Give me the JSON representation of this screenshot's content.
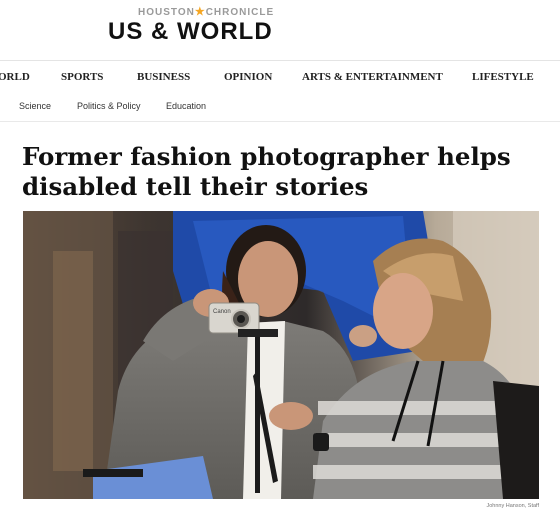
{
  "masthead": {
    "brand_left": "HOUSTON",
    "brand_right": "CHRONICLE",
    "section": "US & WORLD"
  },
  "nav": {
    "items": [
      "ORLD",
      "SPORTS",
      "BUSINESS",
      "OPINION",
      "ARTS & ENTERTAINMENT",
      "LIFESTYLE"
    ]
  },
  "subnav": {
    "items": [
      "Science",
      "Politics & Policy",
      "Education"
    ]
  },
  "article": {
    "headline": "Former fashion photographer helps disabled tell their stories",
    "photo_credit": "Johnny Hanson, Staff"
  },
  "photo": {
    "camera_brand": "Canon"
  },
  "colors": {
    "star": "#f5a623",
    "brand_gray": "#9a9a9a"
  }
}
